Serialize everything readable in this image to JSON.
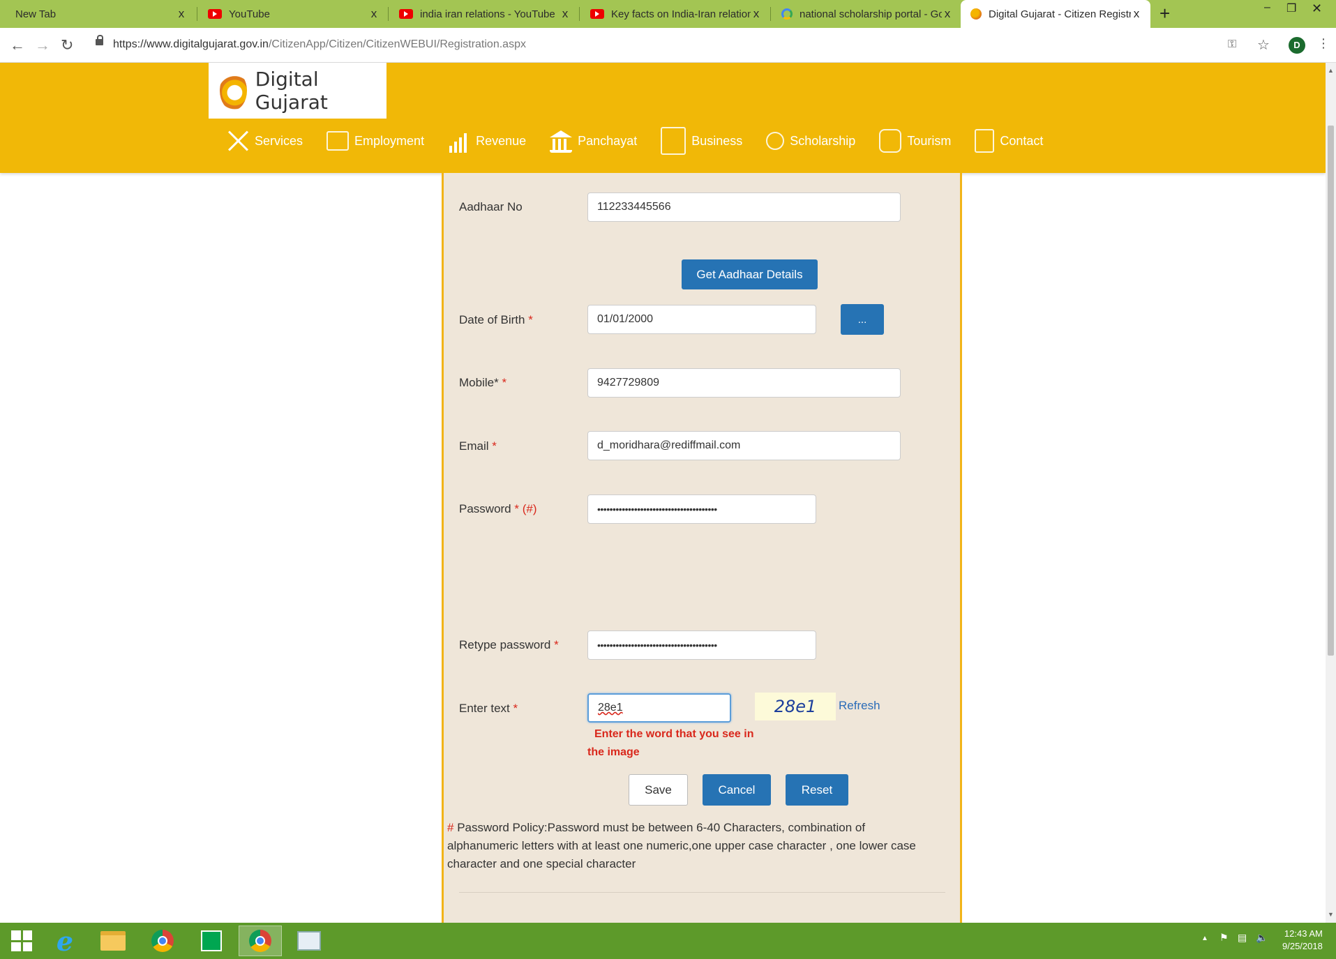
{
  "browser": {
    "tabs": [
      {
        "title": "New Tab",
        "icon": "none"
      },
      {
        "title": "YouTube",
        "icon": "youtube-icon"
      },
      {
        "title": "india iran relations - YouTube",
        "icon": "youtube-icon"
      },
      {
        "title": "Key facts on India-Iran relations -",
        "icon": "youtube-icon"
      },
      {
        "title": "national scholarship portal - Goo",
        "icon": "google-icon"
      },
      {
        "title": "Digital Gujarat - Citizen Registrat",
        "icon": "digital-gujarat-icon"
      }
    ],
    "close_glyph": "x",
    "new_tab_glyph": "+",
    "url_host": "https://www.digitalgujarat.gov.in",
    "url_path": "/CitizenApp/Citizen/CitizenWEBUI/Registration.aspx",
    "profile_initial": "D"
  },
  "site": {
    "logo_text": "Digital Gujarat",
    "menu": [
      {
        "label": "Services",
        "icon": "tools-icon"
      },
      {
        "label": "Employment",
        "icon": "briefcase-icon"
      },
      {
        "label": "Revenue",
        "icon": "bar-chart-icon"
      },
      {
        "label": "Panchayat",
        "icon": "building-icon"
      },
      {
        "label": "Business",
        "icon": "office-icon"
      },
      {
        "label": "Scholarship",
        "icon": "graduation-icon"
      },
      {
        "label": "Tourism",
        "icon": "bus-icon"
      },
      {
        "label": "Contact",
        "icon": "phone-book-icon"
      }
    ]
  },
  "form": {
    "aadhaar_label": "Aadhaar No",
    "aadhaar_value": "112233445566",
    "get_aadhaar_button": "Get Aadhaar Details",
    "dob_label": "Date of Birth",
    "dob_value": "01/01/2000",
    "dob_picker_button": "...",
    "mobile_label": "Mobile*",
    "mobile_value": "9427729809",
    "email_label": "Email",
    "email_value": "d_moridhara@rediffmail.com",
    "password_label": "Password",
    "password_note": "(#)",
    "password_value": "•••••••••••••••••••••••••••••••••••••••",
    "retype_label": "Retype password",
    "retype_value": "•••••••••••••••••••••••••••••••••••••••",
    "captcha_label": "Enter text",
    "captcha_input": "28e1",
    "captcha_image_text": "28e1",
    "refresh_link": "Refresh",
    "captcha_error": "Enter the word that you see in the image",
    "required_mark": "*",
    "save_button": "Save",
    "cancel_button": "Cancel",
    "reset_button": "Reset",
    "policy_hash": "#",
    "policy_text": " Password Policy:Password must be between 6-40 Characters, combination of alphanumeric letters with at least one numeric,one upper case character , one lower case character and one special character"
  },
  "taskbar": {
    "time": "12:43 AM",
    "date": "9/25/2018"
  },
  "colors": {
    "header_yellow": "#f1b807",
    "button_blue": "#2673b4",
    "panel_beige": "#efe6d9",
    "error_red": "#d9281c",
    "taskbar_green": "#5d9a2a"
  }
}
